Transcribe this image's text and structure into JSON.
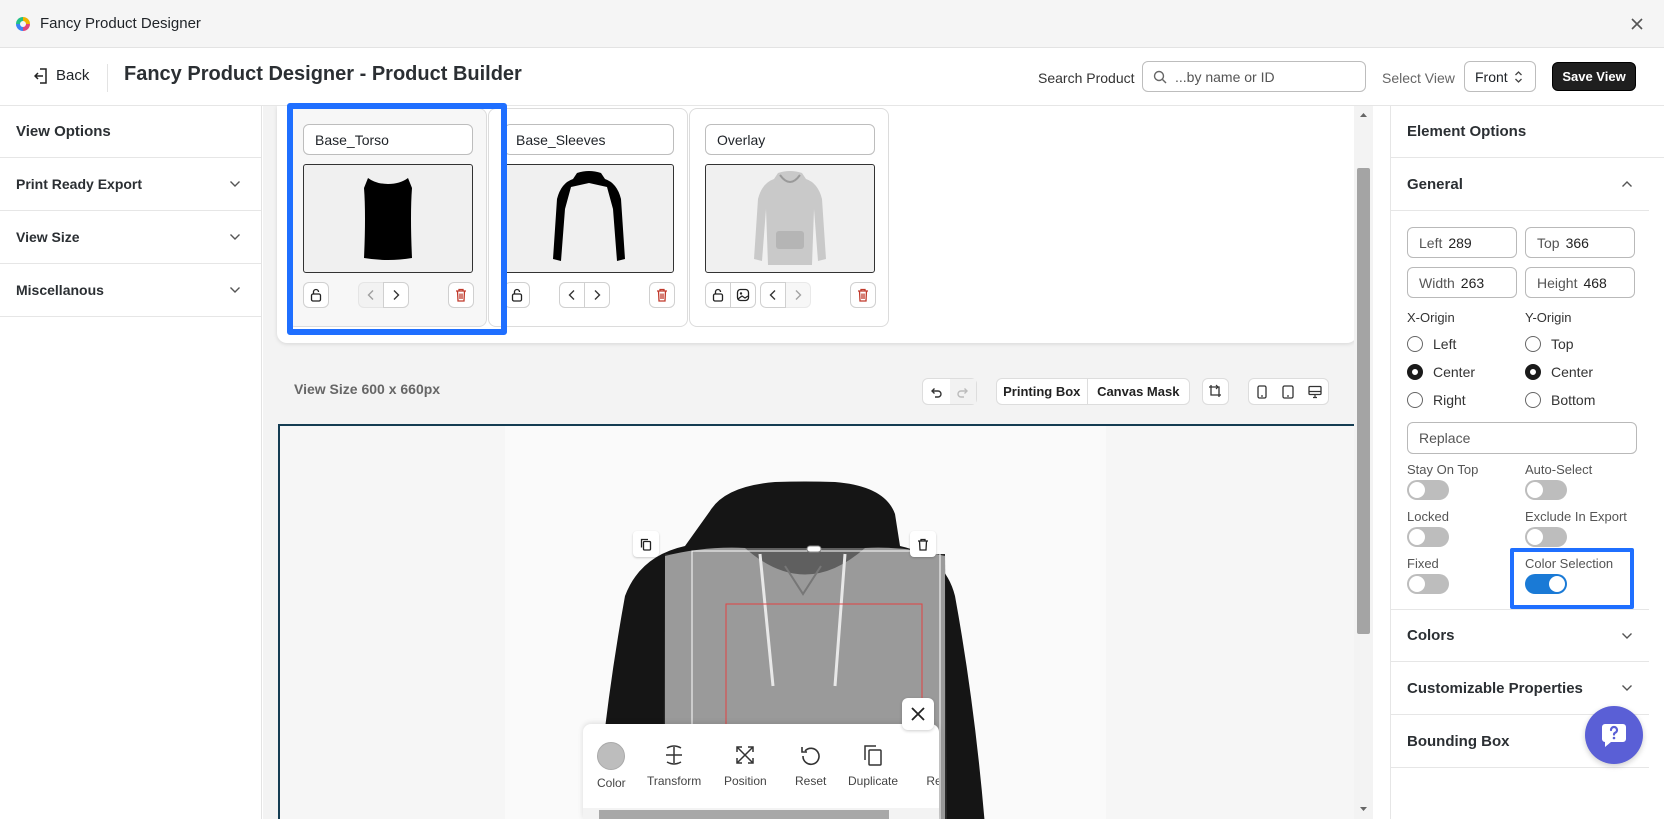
{
  "window": {
    "title": "Fancy Product Designer"
  },
  "header": {
    "back_label": "Back",
    "page_title": "Fancy Product Designer - Product Builder",
    "search_label": "Search Product",
    "search_placeholder": "...by name or ID",
    "select_view_label": "Select View",
    "select_view_value": "Front",
    "save_view_label": "Save View"
  },
  "left_sidebar": {
    "title": "View Options",
    "items": [
      {
        "label": "Print Ready Export"
      },
      {
        "label": "View Size"
      },
      {
        "label": "Miscellanous"
      }
    ]
  },
  "layers": [
    {
      "name": "Base_Torso",
      "selected": true
    },
    {
      "name": "Base_Sleeves",
      "selected": false
    },
    {
      "name": "Overlay",
      "selected": false
    }
  ],
  "canvas": {
    "view_size_label": "View Size 600 x 660px",
    "printing_box_label": "Printing Box",
    "canvas_mask_label": "Canvas Mask"
  },
  "floating_toolbar": {
    "items": [
      {
        "label": "Color",
        "icon": "color-swatch-icon"
      },
      {
        "label": "Transform",
        "icon": "transform-icon"
      },
      {
        "label": "Position",
        "icon": "position-icon"
      },
      {
        "label": "Reset",
        "icon": "reset-icon"
      },
      {
        "label": "Duplicate",
        "icon": "duplicate-icon"
      },
      {
        "label": "Re",
        "icon": "remove-icon"
      }
    ]
  },
  "right_panel": {
    "title": "Element Options",
    "general": {
      "title": "General",
      "left_label": "Left",
      "left_value": "289",
      "top_label": "Top",
      "top_value": "366",
      "width_label": "Width",
      "width_value": "263",
      "height_label": "Height",
      "height_value": "468",
      "x_origin_label": "X-Origin",
      "y_origin_label": "Y-Origin",
      "x_origin_options": [
        "Left",
        "Center",
        "Right"
      ],
      "x_origin_selected": "Center",
      "y_origin_options": [
        "Top",
        "Center",
        "Bottom"
      ],
      "y_origin_selected": "Center",
      "replace_placeholder": "Replace",
      "toggles": {
        "stay_on_top": {
          "label": "Stay On Top",
          "on": false
        },
        "auto_select": {
          "label": "Auto-Select",
          "on": false
        },
        "locked": {
          "label": "Locked",
          "on": false
        },
        "exclude_in_export": {
          "label": "Exclude In Export",
          "on": false
        },
        "fixed": {
          "label": "Fixed",
          "on": false
        },
        "color_selection": {
          "label": "Color Selection",
          "on": true
        }
      }
    },
    "sections": [
      {
        "label": "Colors"
      },
      {
        "label": "Customizable Properties"
      },
      {
        "label": "Bounding Box"
      }
    ]
  },
  "colors": {
    "accent": "#1f6fff",
    "toggle_on": "#1a7ad6",
    "help": "#5a5fd6",
    "delete": "#c0392b"
  }
}
